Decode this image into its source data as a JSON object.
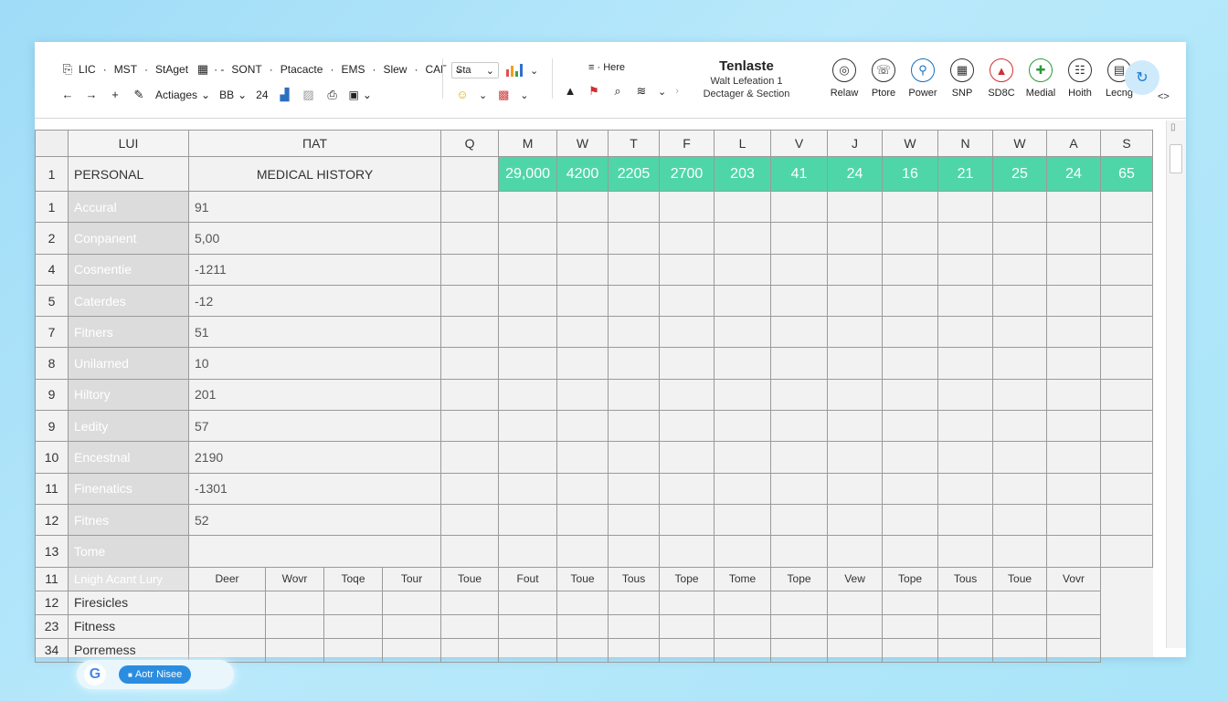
{
  "toolbar": {
    "row1": [
      {
        "icon": "clipboard-icon",
        "glyph": "⎘",
        "label": "LIC"
      },
      {
        "label": "·"
      },
      {
        "label": "MST"
      },
      {
        "label": "·"
      },
      {
        "label": "StAget"
      },
      {
        "icon": "calendar-icon",
        "glyph": "▦",
        "label": "· -"
      },
      {
        "label": "SONT"
      },
      {
        "label": "·"
      },
      {
        "label": "Ptacacte"
      },
      {
        "label": "·"
      },
      {
        "label": "EMS"
      },
      {
        "label": "·"
      },
      {
        "label": "Slew"
      },
      {
        "label": "·"
      },
      {
        "label": "CAΓ"
      }
    ],
    "row2": {
      "back_glyph": "←",
      "forward_glyph": "→",
      "add_glyph": "+",
      "pen_glyph": "✎",
      "font_select": "Actiages",
      "bold_label": "BB",
      "size_select": "24",
      "stat_select": "Sta",
      "emoji_glyph": "☺",
      "mid_row1": "≡ · Here",
      "warning_glyph": "▲"
    },
    "title": "Tenlaste",
    "subtitle1": "Walt Lefeation 1",
    "subtitle2": "Dectager & Section",
    "right_tools": [
      {
        "name": "globe-icon",
        "glyph": "◎",
        "label": "Relaw",
        "color": "#333333"
      },
      {
        "name": "phone-icon",
        "glyph": "☏",
        "label": "Ptore",
        "color": "#333333"
      },
      {
        "name": "power-icon",
        "glyph": "⚲",
        "label": "Power",
        "color": "#1a6fc0"
      },
      {
        "name": "calculator-icon",
        "glyph": "▦",
        "label": "SNP",
        "color": "#333333"
      },
      {
        "name": "alert-icon",
        "glyph": "▲",
        "label": "SD8C",
        "color": "#d03030"
      },
      {
        "name": "medical-icon",
        "glyph": "✚",
        "label": "Medial",
        "color": "#2a9a3a"
      },
      {
        "name": "health-icon",
        "glyph": "☷",
        "label": "Hoith",
        "color": "#333333"
      },
      {
        "name": "document-icon",
        "glyph": "▤",
        "label": "Lecng",
        "color": "#333333"
      }
    ],
    "expand_glyph": "<>"
  },
  "grid": {
    "columns": [
      "LUI",
      "ΠAT",
      "Q",
      "M",
      "W",
      "T",
      "F",
      "L",
      "V",
      "J",
      "W",
      "N",
      "W",
      "A",
      "S"
    ],
    "header_row": {
      "row_num": "1",
      "personal": "PERSONAL",
      "history": "MEDICAL HISTORY",
      "stats": [
        "29,000",
        "4200",
        "2205",
        "2700",
        "203",
        "41",
        "24",
        "16",
        "21",
        "25",
        "24",
        "65"
      ]
    },
    "rows": [
      {
        "num": "1",
        "label": "Accural",
        "value": "91"
      },
      {
        "num": "2",
        "label": "Conpanent",
        "value": "5,00"
      },
      {
        "num": "4",
        "label": "Cosnentie",
        "value": "-1211"
      },
      {
        "num": "5",
        "label": "Caterdes",
        "value": "-12"
      },
      {
        "num": "7",
        "label": "Fitners",
        "value": "51"
      },
      {
        "num": "8",
        "label": "Unilarned",
        "value": "10"
      },
      {
        "num": "9",
        "label": "Hiltory",
        "value": "201"
      },
      {
        "num": "9",
        "label": "Ledity",
        "value": "57"
      },
      {
        "num": "10",
        "label": "Encestnal",
        "value": "2190"
      },
      {
        "num": "11",
        "label": "Finenatics",
        "value": "-1301"
      },
      {
        "num": "12",
        "label": "Fitnes",
        "value": "52"
      },
      {
        "num": "13",
        "label": "Tome",
        "value": ""
      }
    ],
    "sub_header": {
      "num": "11",
      "label": "Lnigh Acant Lury",
      "cells": [
        "Deer",
        "Wovr",
        "Toqe",
        "Tour",
        "Toue",
        "Fout",
        "Toue",
        "Tous",
        "Tope",
        "Tome",
        "Tope",
        "Vew",
        "Tope",
        "Tous",
        "Toue",
        "Vovr"
      ]
    },
    "footer_rows": [
      {
        "num": "12",
        "label": "Firesicles"
      },
      {
        "num": "23",
        "label": "Fitness"
      },
      {
        "num": "34",
        "label": "Porremess"
      }
    ]
  },
  "bottom_bar": {
    "google_glyph": "G",
    "button_label": "Aotr Nisee"
  },
  "colors": {
    "accent": "#4fd6a8",
    "button": "#2b8de0"
  }
}
